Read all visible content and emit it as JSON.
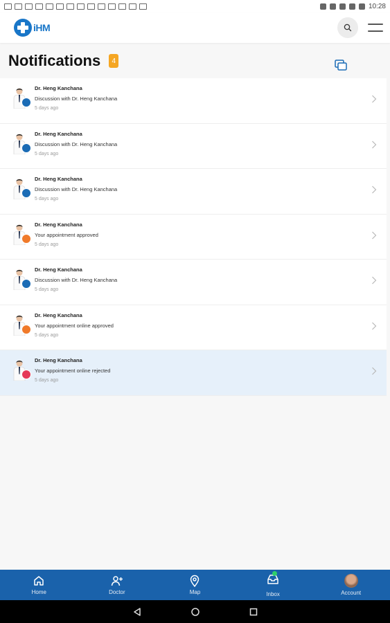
{
  "status_bar": {
    "time": "10:28"
  },
  "header": {
    "logo_text": "iHM"
  },
  "page": {
    "title": "Notifications",
    "unread_count": "4"
  },
  "notifications": [
    {
      "sender": "Dr. Heng Kanchana",
      "message": "Discussion with Dr. Heng Kanchana",
      "time": "5 days ago",
      "type": "chat",
      "badge_icon": "chat-icon"
    },
    {
      "sender": "Dr. Heng Kanchana",
      "message": "Discussion with Dr. Heng Kanchana",
      "time": "5 days ago",
      "type": "chat",
      "badge_icon": "chat-icon"
    },
    {
      "sender": "Dr. Heng Kanchana",
      "message": "Discussion with Dr. Heng Kanchana",
      "time": "5 days ago",
      "type": "chat",
      "badge_icon": "chat-icon"
    },
    {
      "sender": "Dr. Heng Kanchana",
      "message": "Your appointment approved",
      "time": "5 days ago",
      "type": "appt-ok",
      "badge_icon": "calendar-icon"
    },
    {
      "sender": "Dr. Heng Kanchana",
      "message": "Discussion with Dr. Heng Kanchana",
      "time": "5 days ago",
      "type": "chat",
      "badge_icon": "chat-icon"
    },
    {
      "sender": "Dr. Heng Kanchana",
      "message": "Your appointment online approved",
      "time": "5 days ago",
      "type": "appt-ok",
      "badge_icon": "calendar-icon"
    },
    {
      "sender": "Dr. Heng Kanchana",
      "message": "Your appointment online rejected",
      "time": "5 days ago",
      "type": "appt-rej",
      "badge_icon": "calendar-icon"
    }
  ],
  "bottom_nav": {
    "home": "Home",
    "doctor": "Doctor",
    "map": "Map",
    "inbox": "Inbox",
    "account": "Account"
  },
  "colors": {
    "brand_blue": "#1a62ab",
    "badge_orange": "#f5a623",
    "chat_badge": "#1a6bb5",
    "approved_badge": "#f07a2a",
    "rejected_badge": "#e53958",
    "highlight_row": "#e6f0fa"
  }
}
